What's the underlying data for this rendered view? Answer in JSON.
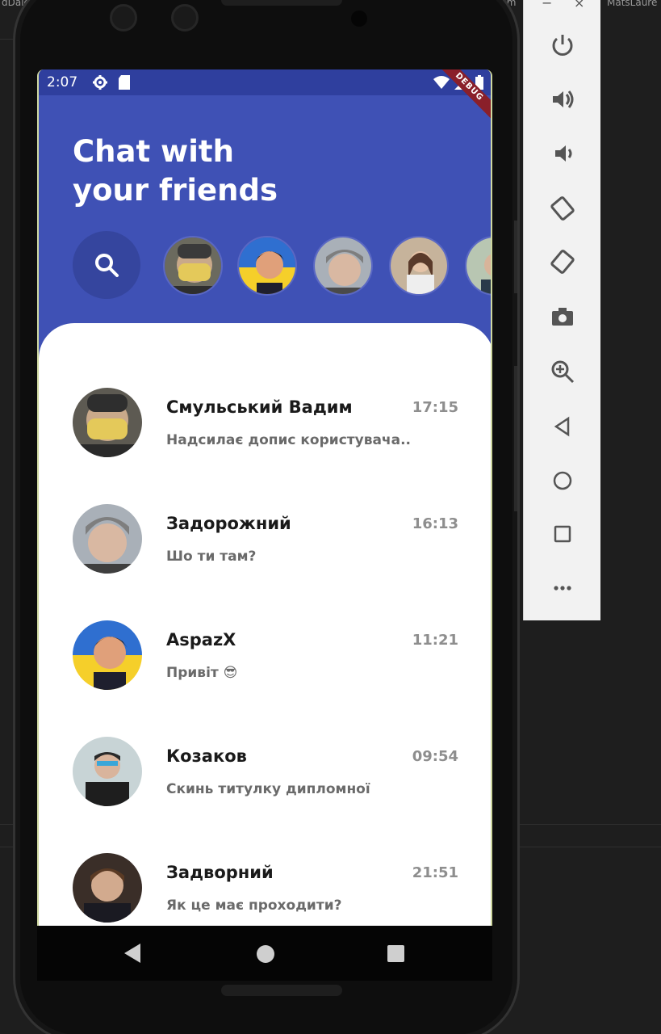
{
  "ide": {
    "top_left_text": "dDaie",
    "top_mid_text": "Com",
    "top_right_text": "MatsLaure"
  },
  "statusbar": {
    "time": "2:07",
    "debug_label": "DEBUG"
  },
  "header": {
    "title": "Chat with your friends"
  },
  "stories": {
    "search_icon": "search-icon",
    "count_visible": 5
  },
  "chats": [
    {
      "name": "Смульський Вадим",
      "time": "17:15",
      "message": "Надсилає допис користувача.."
    },
    {
      "name": "Задорожний",
      "time": "16:13",
      "message": "Шо ти там?"
    },
    {
      "name": "AspazX",
      "time": "11:21",
      "message": "Привіт 😎"
    },
    {
      "name": "Козаков",
      "time": "09:54",
      "message": "Скинь титулку дипломної"
    },
    {
      "name": "Задворний",
      "time": "21:51",
      "message": "Як це має проходити?"
    }
  ],
  "navbar": {
    "back_icon": "back-icon",
    "home_icon": "home-icon",
    "recents_icon": "recents-icon"
  },
  "emulator_toolbar": {
    "minimize": "−",
    "close": "×",
    "buttons": [
      "power-icon",
      "volume-up-icon",
      "volume-down-icon",
      "rotate-left-icon",
      "rotate-right-icon",
      "camera-icon",
      "zoom-icon",
      "back-icon",
      "home-icon",
      "overview-icon",
      "more-icon"
    ]
  },
  "colors": {
    "header_blue": "#3f51b5",
    "status_blue": "#2f3f9e",
    "panel_white": "#ffffff"
  }
}
